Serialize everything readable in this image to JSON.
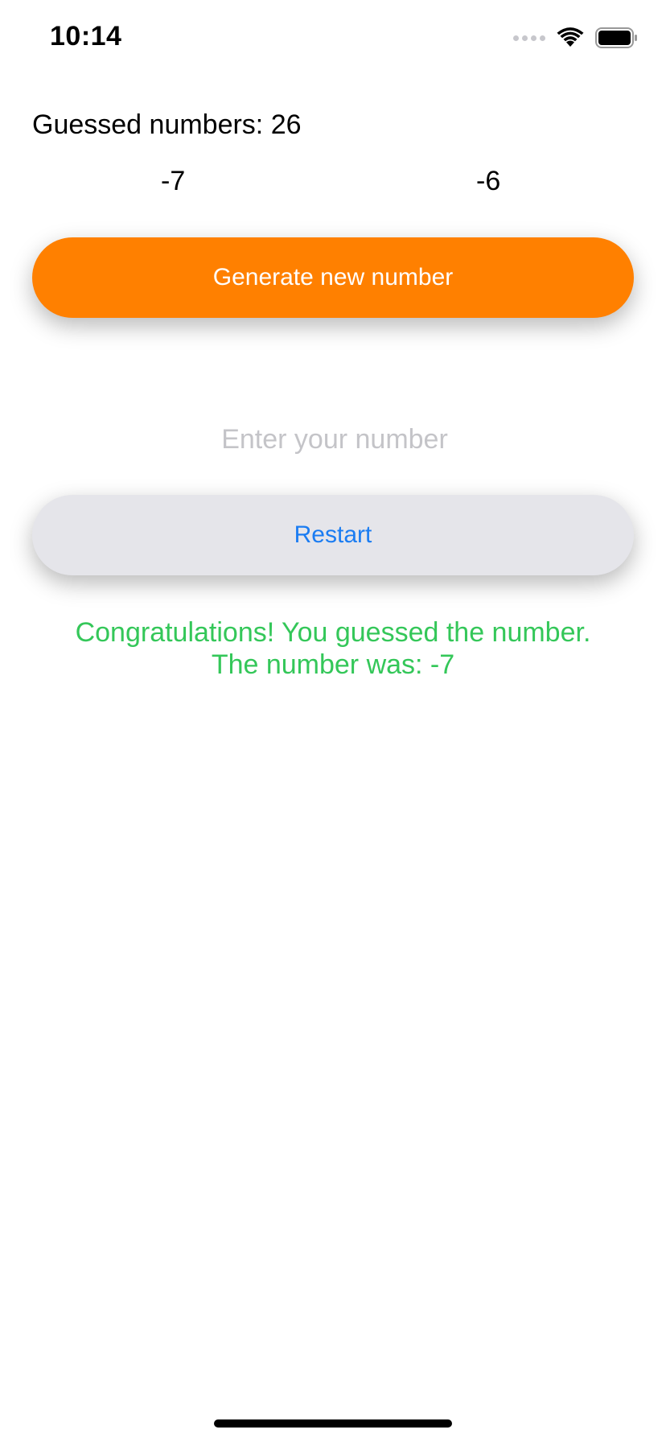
{
  "status_bar": {
    "time": "10:14",
    "icons": [
      "cellular-signal-icon",
      "wifi-icon",
      "battery-icon"
    ]
  },
  "game": {
    "guessed_label": "Guessed numbers: 26",
    "range_min": "-7",
    "range_max": "-6",
    "generate_button_label": "Generate new number",
    "input_placeholder": "Enter your number",
    "input_value": "",
    "restart_button_label": "Restart",
    "result_line1": "Congratulations! You guessed the number.",
    "result_line2": "The number was: -7"
  },
  "colors": {
    "generate_button": "#ff8000",
    "restart_button": "#e5e5ea",
    "restart_text": "#1a7cf2",
    "success_text": "#34c759",
    "placeholder": "#c4c4c8"
  }
}
